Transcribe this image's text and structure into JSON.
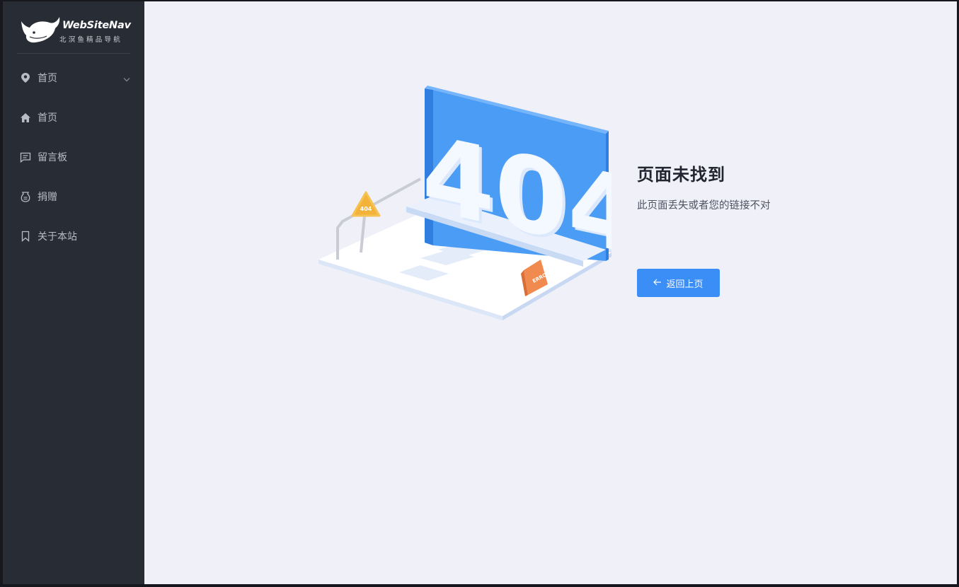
{
  "brand": {
    "name": "WebSiteNav",
    "subtitle": "北溟鱼精品导航",
    "logo_icon": "whale-logo-icon"
  },
  "sidebar": {
    "items": [
      {
        "label": "首页",
        "icon": "location-pin-icon",
        "expandable": true
      },
      {
        "label": "首页",
        "icon": "home-icon"
      },
      {
        "label": "留言板",
        "icon": "message-board-icon"
      },
      {
        "label": "捐赠",
        "icon": "donate-icon"
      },
      {
        "label": "关于本站",
        "icon": "bookmark-icon"
      }
    ]
  },
  "error_page": {
    "illustration_text": "404",
    "sign_text": "404",
    "board_text": "ERROR",
    "title": "页面未找到",
    "description": "此页面丢失或者您的链接不对",
    "back_button": "返回上页",
    "back_icon": "arrow-left-icon"
  },
  "colors": {
    "sidebar_bg": "#282c34",
    "content_bg": "#eff0f8",
    "accent": "#3a8ef6",
    "menu_text": "#b9bcc4"
  }
}
